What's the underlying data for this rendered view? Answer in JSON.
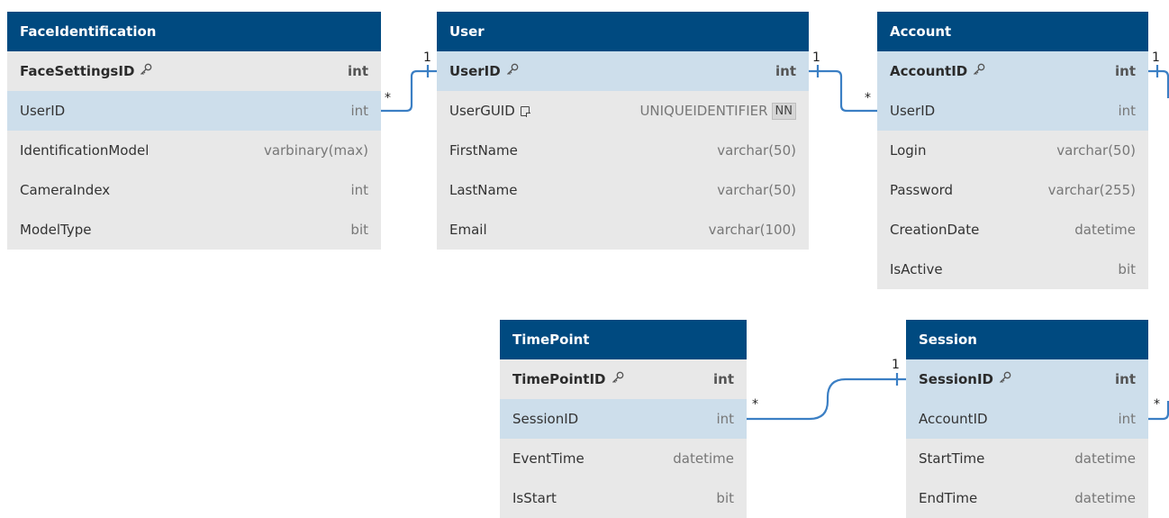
{
  "tables": [
    {
      "id": "faceidentification",
      "name": "FaceIdentification",
      "columns": [
        {
          "name": "FaceSettingsID",
          "type": "int",
          "pk": true,
          "fk": false
        },
        {
          "name": "UserID",
          "type": "int",
          "pk": false,
          "fk": true
        },
        {
          "name": "IdentificationModel",
          "type": "varbinary(max)",
          "pk": false,
          "fk": false
        },
        {
          "name": "CameraIndex",
          "type": "int",
          "pk": false,
          "fk": false
        },
        {
          "name": "ModelType",
          "type": "bit",
          "pk": false,
          "fk": false
        }
      ]
    },
    {
      "id": "user",
      "name": "User",
      "columns": [
        {
          "name": "UserID",
          "type": "int",
          "pk": true,
          "fk": true
        },
        {
          "name": "UserGUID",
          "type": "UNIQUEIDENTIFIER",
          "pk": false,
          "fk": false,
          "note": true,
          "badge": "NN"
        },
        {
          "name": "FirstName",
          "type": "varchar(50)",
          "pk": false,
          "fk": false
        },
        {
          "name": "LastName",
          "type": "varchar(50)",
          "pk": false,
          "fk": false
        },
        {
          "name": "Email",
          "type": "varchar(100)",
          "pk": false,
          "fk": false
        }
      ]
    },
    {
      "id": "account",
      "name": "Account",
      "columns": [
        {
          "name": "AccountID",
          "type": "int",
          "pk": true,
          "fk": true
        },
        {
          "name": "UserID",
          "type": "int",
          "pk": false,
          "fk": true
        },
        {
          "name": "Login",
          "type": "varchar(50)",
          "pk": false,
          "fk": false
        },
        {
          "name": "Password",
          "type": "varchar(255)",
          "pk": false,
          "fk": false
        },
        {
          "name": "CreationDate",
          "type": "datetime",
          "pk": false,
          "fk": false
        },
        {
          "name": "IsActive",
          "type": "bit",
          "pk": false,
          "fk": false
        }
      ]
    },
    {
      "id": "timepoint",
      "name": "TimePoint",
      "columns": [
        {
          "name": "TimePointID",
          "type": "int",
          "pk": true,
          "fk": false
        },
        {
          "name": "SessionID",
          "type": "int",
          "pk": false,
          "fk": true
        },
        {
          "name": "EventTime",
          "type": "datetime",
          "pk": false,
          "fk": false
        },
        {
          "name": "IsStart",
          "type": "bit",
          "pk": false,
          "fk": false
        }
      ]
    },
    {
      "id": "session",
      "name": "Session",
      "columns": [
        {
          "name": "SessionID",
          "type": "int",
          "pk": true,
          "fk": true
        },
        {
          "name": "AccountID",
          "type": "int",
          "pk": false,
          "fk": true
        },
        {
          "name": "StartTime",
          "type": "datetime",
          "pk": false,
          "fk": false
        },
        {
          "name": "EndTime",
          "type": "datetime",
          "pk": false,
          "fk": false
        }
      ]
    }
  ],
  "relationships": [
    {
      "from_table": "faceidentification",
      "from_column": "UserID",
      "from_card": "*",
      "to_table": "user",
      "to_column": "UserID",
      "to_card": "1"
    },
    {
      "from_table": "account",
      "from_column": "UserID",
      "from_card": "*",
      "to_table": "user",
      "to_column": "UserID",
      "to_card": "1"
    },
    {
      "from_table": "timepoint",
      "from_column": "SessionID",
      "from_card": "*",
      "to_table": "session",
      "to_column": "SessionID",
      "to_card": "1"
    },
    {
      "from_table": "account",
      "from_column": "AccountID",
      "from_card": "1",
      "to_table": "offscreen",
      "to_column": "",
      "to_card": ""
    },
    {
      "from_table": "session",
      "from_column": "AccountID",
      "from_card": "*",
      "to_table": "offscreen",
      "to_column": "",
      "to_card": ""
    }
  ],
  "icons": {
    "primary_key": "key-icon",
    "note": "note-icon"
  },
  "colors": {
    "header": "#004a80",
    "fk_row": "#cddeeb",
    "body": "#e8e8e8",
    "connector": "#3b7fc4"
  }
}
